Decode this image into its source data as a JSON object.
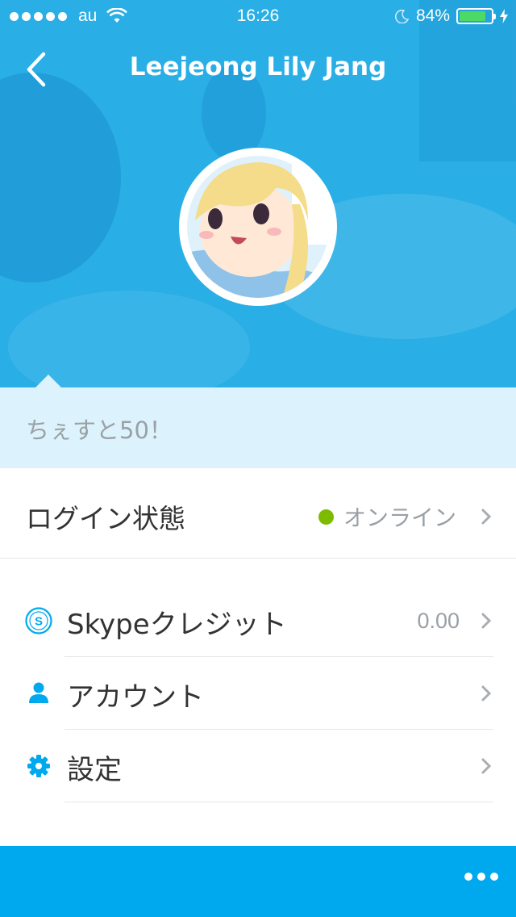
{
  "status_bar": {
    "carrier": "au",
    "time": "16:26",
    "battery": "84%",
    "battery_level": 0.84
  },
  "nav": {
    "title": "Leejeong Lily Jang"
  },
  "mood": {
    "text": "ちぇすと50！"
  },
  "login": {
    "label": "ログイン状態",
    "status": "オンライン",
    "status_color": "#7cbb00"
  },
  "menu": [
    {
      "label": "Skypeクレジット",
      "value": "0.00",
      "icon": "skype-credit-icon"
    },
    {
      "label": "アカウント",
      "value": "",
      "icon": "person-icon"
    },
    {
      "label": "設定",
      "value": "",
      "icon": "gear-icon"
    }
  ],
  "colors": {
    "header_bg": "#29aee6",
    "accent": "#00a9ee",
    "mood_bg": "#dcf2fc"
  }
}
